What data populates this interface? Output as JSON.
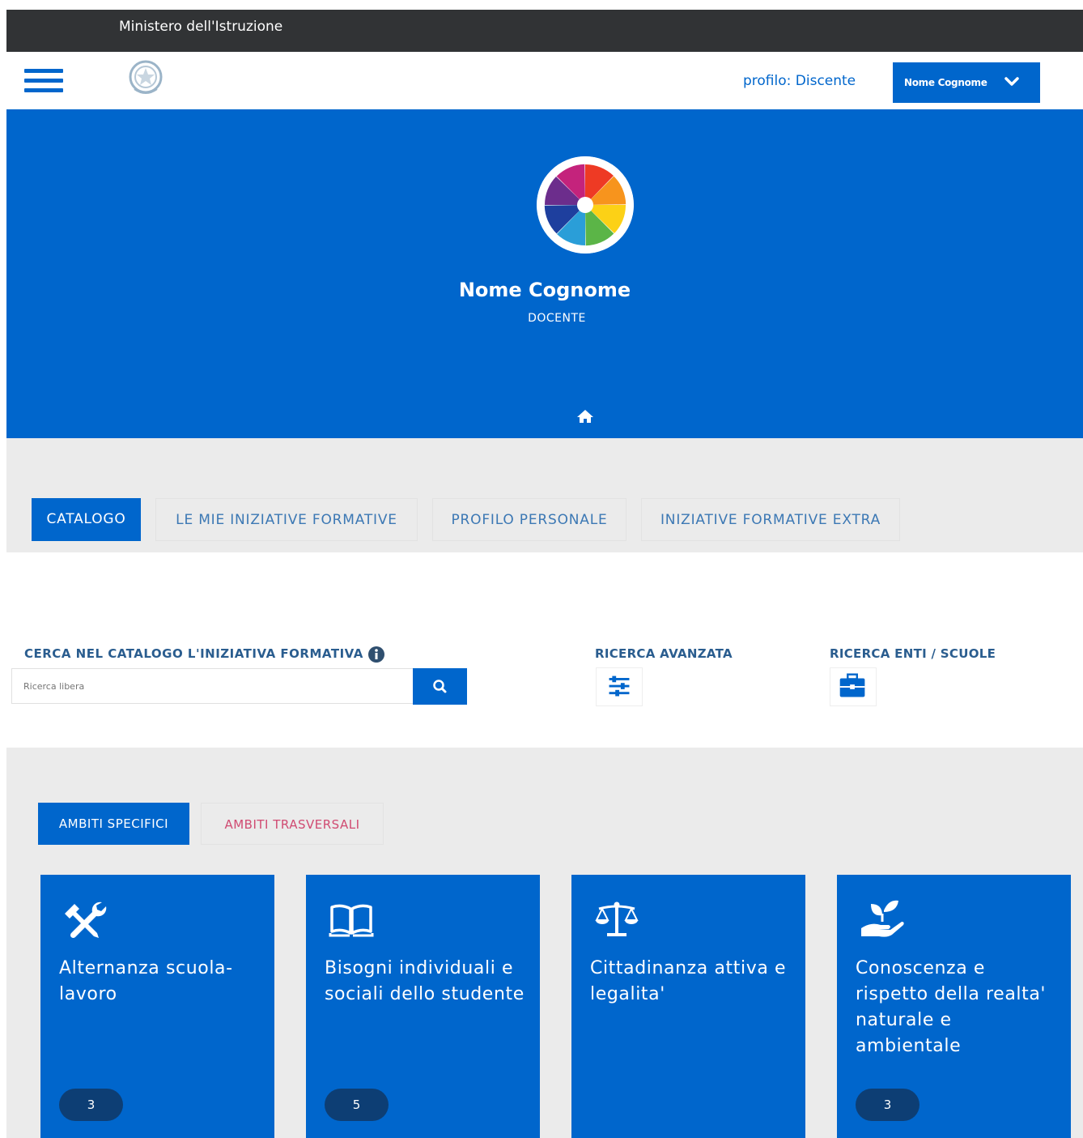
{
  "topbar": {
    "title": "Ministero dell'Istruzione"
  },
  "header": {
    "profile_text": "profilo: Discente",
    "user_button_label": "Nome Cognome"
  },
  "hero": {
    "name": "Nome Cognome",
    "role": "DOCENTE"
  },
  "tabs": [
    {
      "label": "CATALOGO",
      "active": true
    },
    {
      "label": "LE MIE INIZIATIVE FORMATIVE",
      "active": false
    },
    {
      "label": "PROFILO PERSONALE",
      "active": false
    },
    {
      "label": "INIZIATIVE FORMATIVE EXTRA",
      "active": false
    }
  ],
  "search": {
    "label": "CERCA NEL CATALOGO L'INIZIATIVA FORMATIVA",
    "placeholder": "Ricerca libera",
    "advanced_label": "RICERCA AVANZATA",
    "enti_label": "RICERCA ENTI / SCUOLE"
  },
  "subtabs": [
    {
      "label": "AMBITI SPECIFICI",
      "active": true
    },
    {
      "label": "AMBITI TRASVERSALI",
      "active": false
    }
  ],
  "cards": [
    {
      "icon": "tools-icon",
      "label": "Alternanza scuola-lavoro",
      "count": "3"
    },
    {
      "icon": "book-icon",
      "label": "Bisogni individuali e sociali dello studente",
      "count": "5"
    },
    {
      "icon": "scales-icon",
      "label": "Cittadinanza attiva e legalita'",
      "count": ""
    },
    {
      "icon": "plant-hand-icon",
      "label": "Conoscenza e rispetto della realta' naturale e ambientale",
      "count": "3"
    }
  ],
  "colors": {
    "primary": "#0066cc",
    "dark_bar": "#313335",
    "light_bg": "#ebebeb",
    "badge": "#0d3e74",
    "accent_pink": "#d04b72"
  }
}
